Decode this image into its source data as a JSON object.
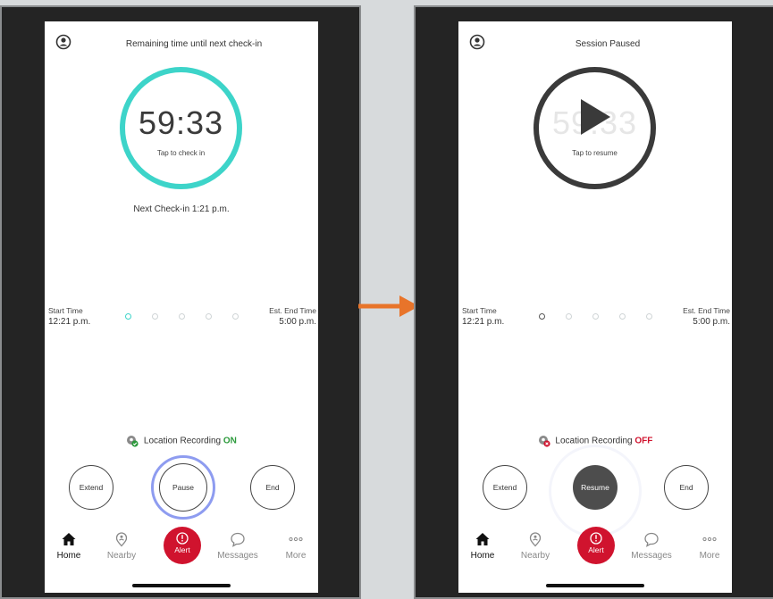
{
  "colors": {
    "timer_active": "#3dd4c9",
    "timer_paused": "#3a3a3a",
    "alert": "#d0132e",
    "location_on": "#2b9a3b",
    "location_off": "#d0132e",
    "pause_ring": "#8e9cf0",
    "arrow": "#e8742a"
  },
  "left": {
    "header_title": "Remaining time until next check-in",
    "timer": "59:33",
    "timer_sub": "Tap to check in",
    "next_checkin": "Next Check-in 1:21 p.m.",
    "start_label": "Start Time",
    "start_value": "12:21 p.m.",
    "end_label": "Est. End Time",
    "end_value": "5:00 p.m.",
    "location_label": "Location Recording",
    "location_state": "ON",
    "extend_label": "Extend",
    "center_label": "Pause",
    "end_button_label": "End"
  },
  "right": {
    "header_title": "Session Paused",
    "timer": "59:33",
    "timer_sub": "Tap to resume",
    "start_label": "Start Time",
    "start_value": "12:21 p.m.",
    "end_label": "Est. End Time",
    "end_value": "5:00 p.m.",
    "location_label": "Location Recording",
    "location_state": "OFF",
    "extend_label": "Extend",
    "center_label": "Resume",
    "end_button_label": "End"
  },
  "tabs": {
    "home": "Home",
    "nearby": "Nearby",
    "alert": "Alert",
    "messages": "Messages",
    "more": "More"
  },
  "icons": [
    "avatar-icon",
    "play-icon",
    "location-pin-icon",
    "check-icon",
    "close-icon",
    "home-icon",
    "nearby-pin-icon",
    "alert-icon",
    "chat-bubble-icon",
    "more-dots-icon",
    "arrow-right-icon"
  ]
}
